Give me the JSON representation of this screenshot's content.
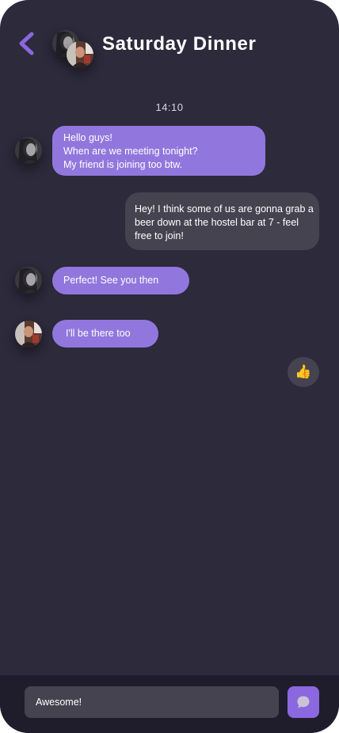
{
  "header": {
    "title": "Saturday Dinner",
    "back_icon": "chevron-left-icon",
    "accent_color": "#8b67e0"
  },
  "chat": {
    "timestamp": "14:10",
    "messages": [
      {
        "direction": "incoming",
        "sender_avatar": "woman-avatar",
        "lines": [
          "Hello guys!",
          "When are we meeting tonight?",
          "My friend is joining too btw."
        ]
      },
      {
        "direction": "outgoing",
        "lines": [
          "Hey! I think some of us are gonna grab a",
          "beer down at the hostel bar at 7 - feel",
          "free to join!"
        ]
      },
      {
        "direction": "incoming",
        "sender_avatar": "woman-avatar",
        "lines": [
          "Perfect! See you then"
        ]
      },
      {
        "direction": "incoming",
        "sender_avatar": "man-avatar",
        "lines": [
          "I'll be there too"
        ]
      }
    ],
    "reaction": {
      "emoji": "👍",
      "icon": "thumbs-up-icon"
    }
  },
  "composer": {
    "input_value": "Awesome!",
    "send_icon": "chat-bubble-icon"
  },
  "colors": {
    "background": "#2c2a3b",
    "incoming_bubble": "#9177dd",
    "outgoing_bubble": "#454350",
    "composer_bar": "#1f1d2b"
  }
}
